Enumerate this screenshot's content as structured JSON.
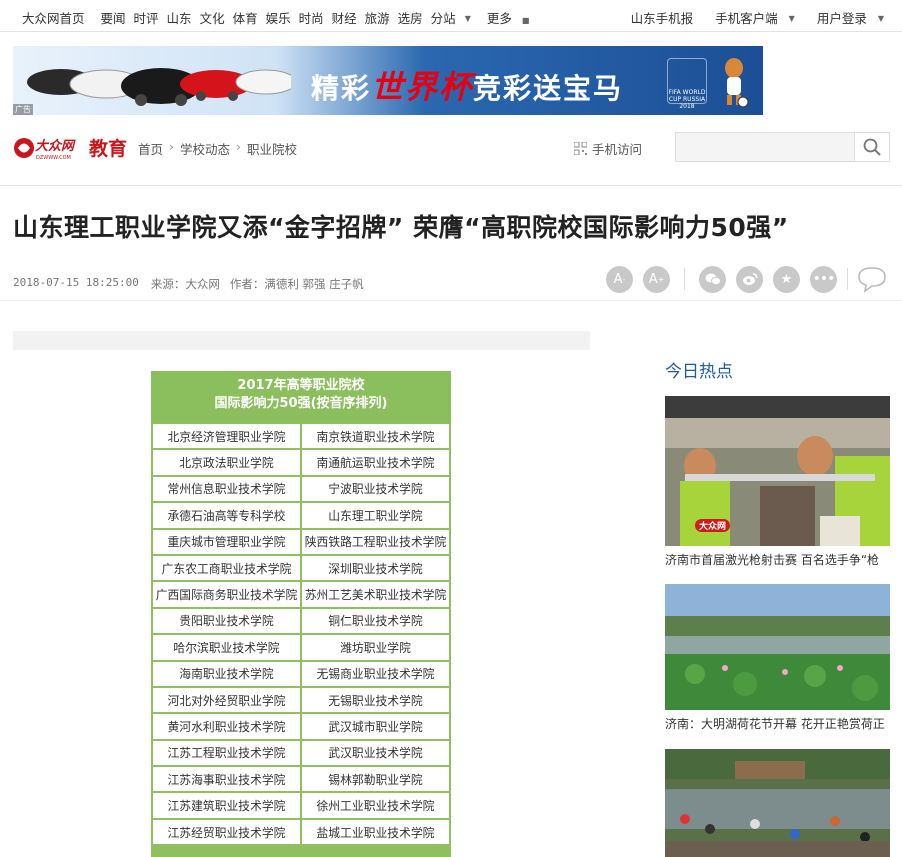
{
  "topnav": {
    "home": "大众网首页",
    "items": [
      "要闻",
      "时评",
      "山东",
      "文化",
      "体育",
      "娱乐",
      "时尚",
      "财经",
      "旅游",
      "选房",
      "分站",
      "更多"
    ],
    "right": [
      "山东手机报",
      "手机客户端",
      "用户登录"
    ]
  },
  "banner": {
    "slogan_a": "精彩",
    "slogan_b": "世界杯",
    "slogan_c": "竞彩送宝马",
    "cup_text": "FIFA WORLD CUP RUSSIA 2018",
    "ad_mark": "广告"
  },
  "channel": {
    "logo_text": "大众网",
    "logo_url_text": "DZWWW.COM",
    "name": "教育",
    "breadcrumb": [
      "首页",
      "学校动态",
      "职业院校"
    ],
    "mobile_visit": "手机访问",
    "search_placeholder": ""
  },
  "article": {
    "title": "山东理工职业学院又添“金字招牌” 荣膺“高职院校国际影响力50强”",
    "date": "2018-07-15 18:25:00",
    "source": "来源：大众网",
    "author": "作者：",
    "authors": "满德利 郭强 庄子帆"
  },
  "toolbar": {
    "font_smaller": "A",
    "font_larger": "A",
    "icons": [
      "wechat-icon",
      "weibo-icon",
      "favorite-icon",
      "more-icon",
      "comment-icon"
    ]
  },
  "rank_image": {
    "title_line1": "2017年高等职业院校",
    "title_line2": "国际影响力50强(按音序排列)",
    "rows": [
      [
        "北京经济管理职业学院",
        "南京铁道职业技术学院"
      ],
      [
        "北京政法职业学院",
        "南通航运职业技术学院"
      ],
      [
        "常州信息职业技术学院",
        "宁波职业技术学院"
      ],
      [
        "承德石油高等专科学校",
        "山东理工职业学院"
      ],
      [
        "重庆城市管理职业学院",
        "陕西铁路工程职业技术学院"
      ],
      [
        "广东农工商职业技术学院",
        "深圳职业技术学院"
      ],
      [
        "广西国际商务职业技术学院",
        "苏州工艺美术职业技术学院"
      ],
      [
        "贵阳职业技术学院",
        "铜仁职业技术学院"
      ],
      [
        "哈尔滨职业技术学院",
        "潍坊职业学院"
      ],
      [
        "海南职业技术学院",
        "无锡商业职业技术学院"
      ],
      [
        "河北对外经贸职业学院",
        "无锡职业技术学院"
      ],
      [
        "黄河水利职业技术学院",
        "武汉城市职业学院"
      ],
      [
        "江苏工程职业技术学院",
        "武汉职业技术学院"
      ],
      [
        "江苏海事职业技术学院",
        "锡林郭勒职业学院"
      ],
      [
        "江苏建筑职业技术学院",
        "徐州工业职业技术学院"
      ],
      [
        "江苏经贸职业技术学院",
        "盐城工业职业技术学院"
      ]
    ]
  },
  "sidebar": {
    "title": "今日热点",
    "items": [
      {
        "caption": "济南市首届激光枪射击赛 百名选手争“枪"
      },
      {
        "caption": "济南：大明湖荷花节开幕 花开正艳赏荷正"
      },
      {
        "caption": ""
      }
    ]
  }
}
